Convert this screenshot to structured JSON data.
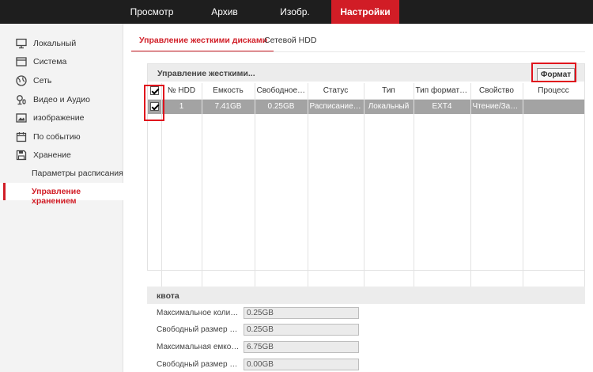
{
  "topnav": {
    "items": [
      {
        "label": "Просмотр",
        "active": false
      },
      {
        "label": "Архив",
        "active": false
      },
      {
        "label": "Изобр.",
        "active": false
      },
      {
        "label": "Настройки",
        "active": true
      }
    ]
  },
  "sidebar": {
    "items": [
      {
        "label": "Локальный",
        "icon": "monitor-icon"
      },
      {
        "label": "Система",
        "icon": "system-icon"
      },
      {
        "label": "Сеть",
        "icon": "globe-icon"
      },
      {
        "label": "Видео и Аудио",
        "icon": "camera-mic-icon"
      },
      {
        "label": "изображение",
        "icon": "image-icon"
      },
      {
        "label": "По событию",
        "icon": "calendar-icon"
      },
      {
        "label": "Хранение",
        "icon": "save-icon"
      }
    ],
    "subitems": [
      {
        "label": "Параметры расписания",
        "active": false
      },
      {
        "label": "Управление хранением",
        "active": true
      }
    ]
  },
  "tabs": [
    {
      "label": "Управление жесткими дисками",
      "active": true
    },
    {
      "label": "Сетевой HDD",
      "active": false
    }
  ],
  "hdd_panel": {
    "title": "Управление жесткими...",
    "format_button": "Формат",
    "columns": [
      "№ HDD",
      "Емкость",
      "Свободное м...",
      "Статус",
      "Тип",
      "Тип форматир...",
      "Свойство",
      "Процесс"
    ],
    "rows": [
      {
        "checked": true,
        "cells": [
          "1",
          "7.41GB",
          "0.25GB",
          "Расписание за...",
          "Локальный",
          "EXT4",
          "Чтение/Запись",
          ""
        ]
      }
    ]
  },
  "quota": {
    "title": "квота",
    "fields": [
      {
        "label": "Максимальное колич. К...",
        "value": "0.25GB"
      },
      {
        "label": "Свободный размер для...",
        "value": "0.25GB"
      },
      {
        "label": "Максимальная емкость...",
        "value": "6.75GB"
      },
      {
        "label": "Свободный размер для...",
        "value": "0.00GB"
      }
    ]
  },
  "colors": {
    "accent": "#d11d26",
    "topbar": "#1e1e1e",
    "selected_row": "#a3a3a3"
  }
}
